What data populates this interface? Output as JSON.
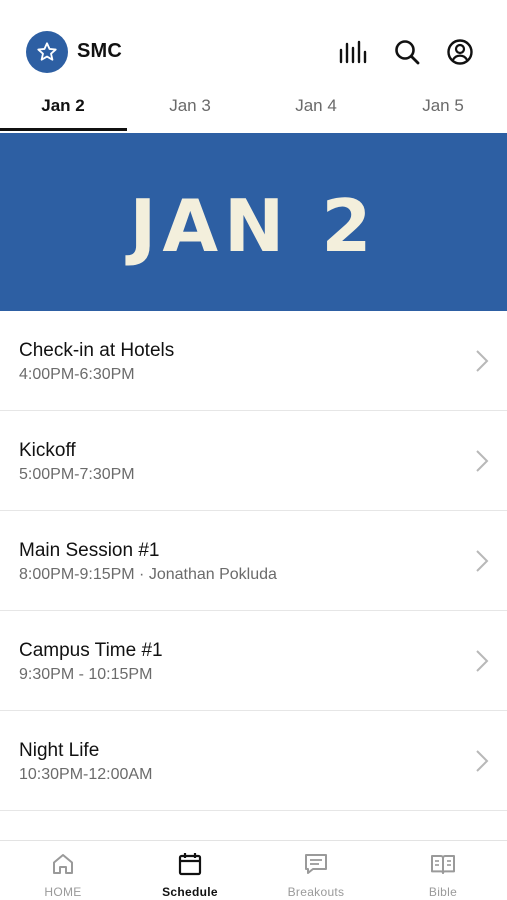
{
  "header": {
    "brand": "SMC"
  },
  "date_tabs": [
    {
      "label": "Jan 2",
      "active": true
    },
    {
      "label": "Jan 3",
      "active": false
    },
    {
      "label": "Jan 4",
      "active": false
    },
    {
      "label": "Jan 5",
      "active": false
    }
  ],
  "banner": {
    "text": "JAN 2",
    "background": "#2d5fa3",
    "text_color": "#f3efdc"
  },
  "schedule": [
    {
      "title": "Check-in at Hotels",
      "subtitle": "4:00PM-6:30PM"
    },
    {
      "title": "Kickoff",
      "subtitle": "5:00PM-7:30PM"
    },
    {
      "title": "Main Session #1",
      "subtitle": "8:00PM-9:15PM · Jonathan Pokluda"
    },
    {
      "title": "Campus Time #1",
      "subtitle": "9:30PM - 10:15PM"
    },
    {
      "title": "Night Life",
      "subtitle": "10:30PM-12:00AM"
    }
  ],
  "bottom_nav": [
    {
      "label": "HOME",
      "icon": "home-icon",
      "active": false
    },
    {
      "label": "Schedule",
      "icon": "calendar-icon",
      "active": true
    },
    {
      "label": "Breakouts",
      "icon": "chat-icon",
      "active": false
    },
    {
      "label": "Bible",
      "icon": "book-icon",
      "active": false
    }
  ],
  "colors": {
    "accent": "#2d5fa3",
    "banner_text": "#f3efdc"
  }
}
